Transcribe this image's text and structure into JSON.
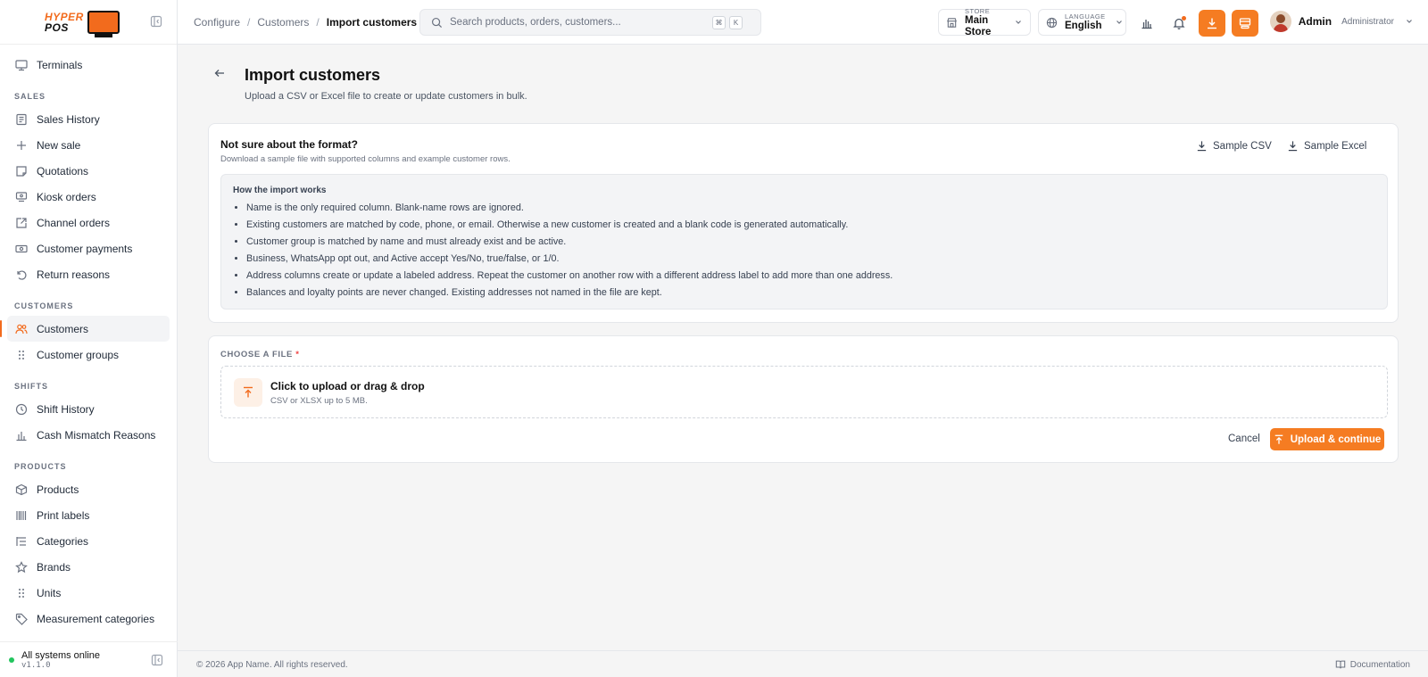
{
  "brand": {
    "name_top": "HYPER",
    "name_bottom": "POS",
    "accent": "#f57c22"
  },
  "sidebar": {
    "top_items": [
      {
        "label": "Terminals",
        "icon": "terminal-icon"
      }
    ],
    "sections": [
      {
        "title": "SALES",
        "items": [
          {
            "label": "Sales History",
            "icon": "receipt-icon"
          },
          {
            "label": "New sale",
            "icon": "plus-icon"
          },
          {
            "label": "Quotations",
            "icon": "note-icon"
          },
          {
            "label": "Kiosk orders",
            "icon": "kiosk-icon"
          },
          {
            "label": "Channel orders",
            "icon": "external-link-icon"
          },
          {
            "label": "Customer payments",
            "icon": "cash-icon"
          },
          {
            "label": "Return reasons",
            "icon": "undo-icon"
          }
        ]
      },
      {
        "title": "CUSTOMERS",
        "items": [
          {
            "label": "Customers",
            "icon": "users-icon",
            "active": true
          },
          {
            "label": "Customer groups",
            "icon": "grip-icon"
          }
        ]
      },
      {
        "title": "SHIFTS",
        "items": [
          {
            "label": "Shift History",
            "icon": "history-icon"
          },
          {
            "label": "Cash Mismatch Reasons",
            "icon": "bar-chart-icon"
          }
        ]
      },
      {
        "title": "PRODUCTS",
        "items": [
          {
            "label": "Products",
            "icon": "box-icon"
          },
          {
            "label": "Print labels",
            "icon": "barcode-icon"
          },
          {
            "label": "Categories",
            "icon": "list-tree-icon"
          },
          {
            "label": "Brands",
            "icon": "star-icon"
          },
          {
            "label": "Units",
            "icon": "grip-icon"
          },
          {
            "label": "Measurement categories",
            "icon": "tag-icon"
          }
        ]
      }
    ],
    "status": {
      "text": "All systems online",
      "version": "v1.1.0",
      "color": "#22c55e"
    }
  },
  "topbar": {
    "breadcrumb": [
      "Configure",
      "Customers",
      "Import customers"
    ],
    "search": {
      "placeholder": "Search products, orders, customers...",
      "shortcut": [
        "⌘",
        "K"
      ]
    },
    "store": {
      "label": "STORE",
      "value": "Main Store"
    },
    "language": {
      "label": "LANGUAGE",
      "value": "English"
    },
    "user": {
      "name": "Admin",
      "role": "Administrator"
    }
  },
  "page": {
    "title": "Import customers",
    "subtitle": "Upload a CSV or Excel file to create or update customers in bulk."
  },
  "format_card": {
    "title": "Not sure about the format?",
    "subtitle": "Download a sample file with supported columns and example customer rows.",
    "sample_csv": "Sample CSV",
    "sample_excel": "Sample Excel",
    "how_title": "How the import works",
    "rules": [
      "Name is the only required column. Blank-name rows are ignored.",
      "Existing customers are matched by code, phone, or email. Otherwise a new customer is created and a blank code is generated automatically.",
      "Customer group is matched by name and must already exist and be active.",
      "Business, WhatsApp opt out, and Active accept Yes/No, true/false, or 1/0.",
      "Address columns create or update a labeled address. Repeat the customer on another row with a different address label to add more than one address.",
      "Balances and loyalty points are never changed. Existing addresses not named in the file are kept."
    ]
  },
  "upload_card": {
    "label": "CHOOSE A FILE",
    "required_mark": "*",
    "drop_title": "Click to upload or drag & drop",
    "drop_hint": "CSV or XLSX up to 5 MB.",
    "cancel": "Cancel",
    "submit": "Upload & continue"
  },
  "footer": {
    "copyright": "© 2026 App Name. All rights reserved.",
    "docs": "Documentation"
  }
}
